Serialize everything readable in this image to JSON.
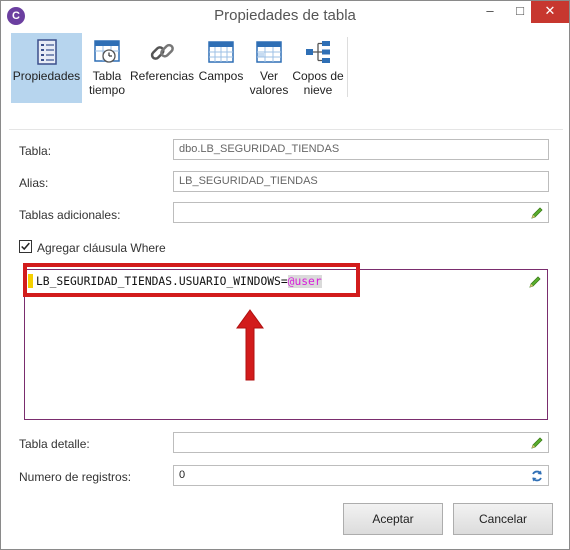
{
  "window": {
    "title": "Propiedades de tabla",
    "app_icon_letter": "C",
    "min_glyph": "–",
    "max_glyph": "□",
    "close_glyph": "✕"
  },
  "toolbar": {
    "items": [
      {
        "label": "Propiedades",
        "icon": "properties-icon",
        "active": true
      },
      {
        "label": "Tabla tiempo",
        "icon": "calendar-clock-icon",
        "active": false
      },
      {
        "label": "Referencias",
        "icon": "chain-link-icon",
        "active": false
      },
      {
        "label": "Campos",
        "icon": "grid-icon",
        "active": false
      },
      {
        "label": "Ver valores",
        "icon": "table-values-icon",
        "active": false
      },
      {
        "label": "Copos de nieve",
        "icon": "snowflake-hierarchy-icon",
        "active": false
      }
    ]
  },
  "form": {
    "tabla_label": "Tabla:",
    "tabla_value": "dbo.LB_SEGURIDAD_TIENDAS",
    "alias_label": "Alias:",
    "alias_value": "LB_SEGURIDAD_TIENDAS",
    "adicionales_label": "Tablas adicionales:",
    "adicionales_value": "",
    "where_checkbox_label": "Agregar cláusula Where",
    "where_checked": true,
    "where_code_prefix": "LB_SEGURIDAD_TIENDAS.USUARIO_WINDOWS=",
    "where_code_param": "@user",
    "detalle_label": "Tabla detalle:",
    "detalle_value": "",
    "registros_label": "Numero de registros:",
    "registros_value": "0"
  },
  "buttons": {
    "accept": "Aceptar",
    "cancel": "Cancelar"
  },
  "colors": {
    "highlight_border": "#d21c1c",
    "arrow": "#d21c1c",
    "active_tool": "#b7d5ee",
    "param_text": "#d81ddb"
  }
}
